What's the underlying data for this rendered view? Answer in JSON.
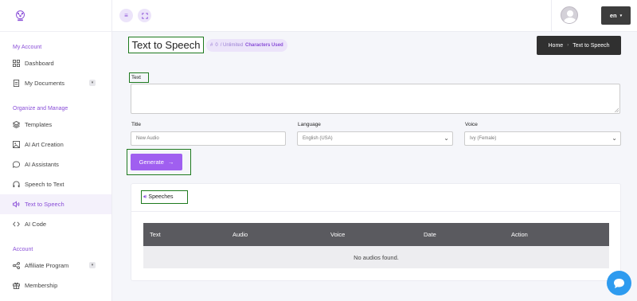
{
  "sidebar": {
    "sections": {
      "my_account": "My Account",
      "organize": "Organize and Manage",
      "account": "Account"
    },
    "items": {
      "dashboard": "Dashboard",
      "my_documents": "My Documents",
      "templates": "Templates",
      "ai_art": "AI Art Creation",
      "ai_assistants": "AI Assistants",
      "speech_to_text": "Speech to Text",
      "text_to_speech": "Text to Speech",
      "ai_code": "AI Code",
      "affiliate": "Affiliate Program",
      "membership": "Membership"
    }
  },
  "topbar": {
    "language": "en"
  },
  "page": {
    "title": "Text to Speech",
    "usage_count": "0",
    "usage_limit": "/ Unlimited",
    "usage_label": "Characters Used"
  },
  "breadcrumb": {
    "home": "Home",
    "current": "Text to Speech"
  },
  "form": {
    "text_label": "Text",
    "title_label": "Title",
    "title_placeholder": "New Audio",
    "language_label": "Language",
    "language_value": "English (USA)",
    "voice_label": "Voice",
    "voice_value": "Ivy (Female)",
    "generate_label": "Generate"
  },
  "speeches": {
    "heading": "Speeches",
    "columns": [
      "Text",
      "Audio",
      "Voice",
      "Date",
      "Action"
    ],
    "empty": "No audios found."
  },
  "colors": {
    "accent": "#8a4fd8",
    "button": "#a05ff0",
    "chat": "#2e9bef"
  }
}
